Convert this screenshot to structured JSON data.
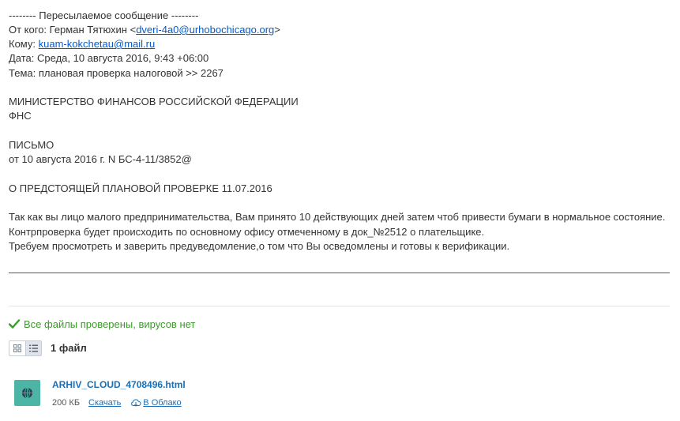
{
  "forward_header": {
    "separator": "-------- Пересылаемое сообщение --------",
    "from_label": "От кого: Герман Тятюхин <",
    "from_email": "dveri-4a0@urhobochicago.org",
    "from_close": ">",
    "to_label": "Кому: ",
    "to_email": "kuam-kokchetau@mail.ru",
    "date_line": "Дата: Среда, 10 августа 2016, 9:43 +06:00",
    "subject_line": "Тема: плановая проверка налоговой >> 2267"
  },
  "body": {
    "org_line1": "МИНИСТЕРСТВО ФИНАНСОВ РОССИЙСКОЙ ФЕДЕРАЦИИ",
    "org_line2": "ФНС",
    "letter_label": "ПИСЬМО",
    "letter_ref": "от 10 августа 2016 г. N БС-4-11/3852@",
    "letter_title": "О ПРЕДСТОЯЩЕЙ ПЛАНОВОЙ ПРОВЕРКЕ 11.07.2016",
    "para1": "Так как вы лицо малого предпринимательства, Вам принято 10 действующих дней затем чтоб привести бумаги в нормальное состояние.",
    "para2": "Контрпроверка будет происходить по основному офису отмеченному в док_№2512 о плательщике.",
    "para3": "Требуем просмотреть и заверить предуведомление,о том что Вы осведомлены и готовы к верификации."
  },
  "attachments": {
    "virus_status": "Все файлы проверены, вирусов нет",
    "count_label": "1 файл",
    "view_modes": [
      "grid-icon",
      "list-icon"
    ],
    "files": [
      {
        "name": "ARHIV_CLOUD_4708496.html",
        "size": "200 КБ",
        "download_label": "Скачать",
        "cloud_label": "В Облако",
        "icon": "globe-icon"
      }
    ]
  },
  "colors": {
    "link": "#005bd1",
    "virus_ok": "#3d9a2d",
    "file_icon_bg": "#4cb5a5",
    "file_link": "#1a6fb5"
  }
}
